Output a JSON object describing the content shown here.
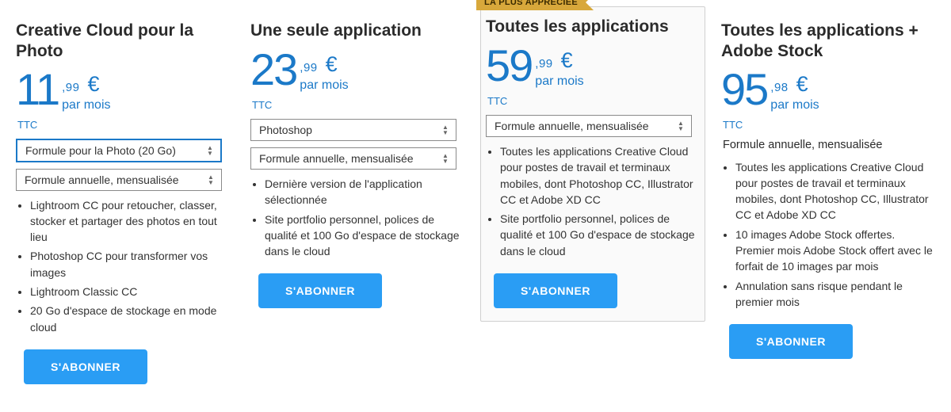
{
  "common": {
    "currency": "€",
    "period": "par mois",
    "tax": "TTC",
    "cta": "S'ABONNER"
  },
  "plans": [
    {
      "title": "Creative Cloud pour la Photo",
      "price_major": "11",
      "price_minor": ",99",
      "select_highlighted": "Formule pour la Photo (20 Go)",
      "select_billing": "Formule annuelle, mensualisée",
      "features": [
        "Lightroom CC pour retoucher, classer, stocker et partager des photos en tout lieu",
        "Photoshop CC pour transformer vos images",
        "Lightroom Classic CC",
        "20 Go d'espace de stockage en mode cloud"
      ]
    },
    {
      "title": "Une seule application",
      "price_major": "23",
      "price_minor": ",99",
      "select_app": "Photoshop",
      "select_billing": "Formule annuelle, mensualisée",
      "features": [
        "Dernière version de l'application sélectionnée",
        "Site portfolio personnel, polices de qualité et 100 Go d'espace de stockage dans le cloud"
      ]
    },
    {
      "ribbon": "LA PLUS APPRÉCIÉE",
      "title": "Toutes les applications",
      "price_major": "59",
      "price_minor": ",99",
      "select_billing": "Formule annuelle, mensualisée",
      "features": [
        "Toutes les applications Creative Cloud pour postes de travail et terminaux mobiles, dont Photoshop CC, Illustrator CC et Adobe XD CC",
        "Site portfolio personnel, polices de qualité et 100 Go d'espace de stockage dans le cloud"
      ]
    },
    {
      "title": "Toutes les applications + Adobe Stock",
      "price_major": "95",
      "price_minor": ",98",
      "plan_static": "Formule annuelle, mensualisée",
      "features": [
        "Toutes les applications Creative Cloud pour postes de travail et terminaux mobiles, dont Photoshop CC, Illustrator CC et Adobe XD CC",
        "10 images Adobe Stock offertes. Premier mois Adobe Stock offert avec le forfait de 10 images par mois",
        "Annulation sans risque pendant le premier mois"
      ]
    }
  ]
}
